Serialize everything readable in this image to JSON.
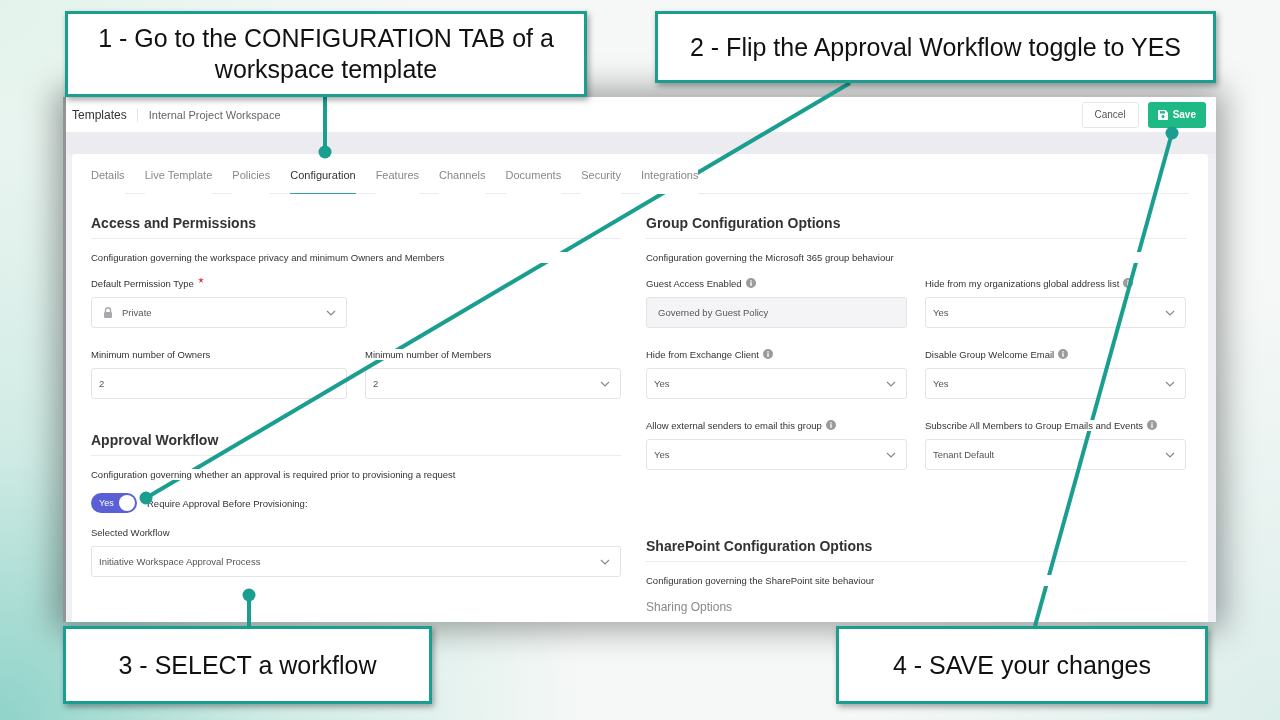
{
  "callouts": [
    {
      "text": "1 - Go to the CONFIGURATION TAB of a workspace template"
    },
    {
      "text": "2 - Flip the Approval Workflow toggle to YES"
    },
    {
      "text": "3 - SELECT a workflow"
    },
    {
      "text": "4 - SAVE your changes"
    }
  ],
  "header": {
    "breadcrumb": [
      "Templates",
      "Internal Project Workspace"
    ],
    "cancel": "Cancel",
    "save": "Save"
  },
  "tabs": [
    {
      "label": "Details",
      "selected": false
    },
    {
      "label": "Live Template",
      "selected": false
    },
    {
      "label": "Policies",
      "selected": false
    },
    {
      "label": "Configuration",
      "selected": true
    },
    {
      "label": "Features",
      "selected": false
    },
    {
      "label": "Channels",
      "selected": false
    },
    {
      "label": "Documents",
      "selected": false
    },
    {
      "label": "Security",
      "selected": false
    },
    {
      "label": "Integrations",
      "selected": false
    }
  ],
  "access": {
    "title": "Access and Permissions",
    "description": "Configuration governing the workspace privacy and minimum Owners and Members",
    "rows": [
      [
        {
          "label": "Default Permission Type",
          "required": true,
          "info": false,
          "kind": "locked_select",
          "value": "Private"
        }
      ],
      [
        {
          "label": "Minimum number of Owners",
          "required": false,
          "info": false,
          "kind": "input",
          "value": "2"
        },
        {
          "label": "Minimum number of Members",
          "required": false,
          "info": false,
          "kind": "select",
          "value": "2"
        }
      ]
    ]
  },
  "approval": {
    "title": "Approval Workflow",
    "description": "Configuration governing whether an approval is required prior to provisioning a request",
    "toggle": {
      "on": true,
      "text": "Yes",
      "label": "Require Approval Before Provisioning:"
    },
    "workflow": {
      "label": "Selected Workflow",
      "required": false,
      "info": false,
      "kind": "select",
      "value": "Initiative Workspace Approval Process"
    }
  },
  "group": {
    "title": "Group Configuration Options",
    "description": "Configuration governing the Microsoft 365 group behaviour",
    "rows": [
      [
        {
          "label": "Guest Access Enabled",
          "required": false,
          "info": true,
          "kind": "readonly",
          "value": "Governed by Guest Policy"
        },
        {
          "label": "Hide from my organizations global address list",
          "required": false,
          "info": true,
          "kind": "select",
          "value": "Yes"
        }
      ],
      [
        {
          "label": "Hide from Exchange Client",
          "required": false,
          "info": true,
          "kind": "select",
          "value": "Yes"
        },
        {
          "label": "Disable Group Welcome Email",
          "required": false,
          "info": true,
          "kind": "select",
          "value": "Yes"
        }
      ],
      [
        {
          "label": "Allow external senders to email this group",
          "required": false,
          "info": true,
          "kind": "select",
          "value": "Yes"
        },
        {
          "label": "Subscribe All Members to Group Emails and Events",
          "required": false,
          "info": true,
          "kind": "select",
          "value": "Tenant Default"
        }
      ]
    ]
  },
  "sharepoint": {
    "title": "SharePoint Configuration Options",
    "description": "Configuration governing the SharePoint site behaviour",
    "subheading": "Sharing Options"
  }
}
